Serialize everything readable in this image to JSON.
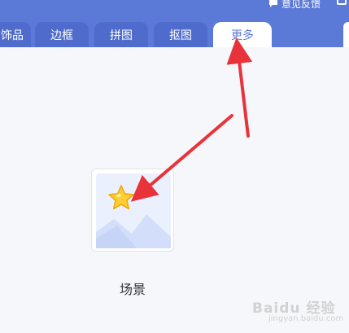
{
  "header": {
    "feedback_label": "意见反馈",
    "tabs": [
      {
        "label": "饰品",
        "active": false
      },
      {
        "label": "边框",
        "active": false
      },
      {
        "label": "拼图",
        "active": false
      },
      {
        "label": "抠图",
        "active": false
      },
      {
        "label": "更多",
        "active": true
      }
    ]
  },
  "main": {
    "scene_card_label": "场景"
  },
  "watermark": {
    "text": "Baidu 经验",
    "sub": "jingyan.baidu.com"
  },
  "colors": {
    "header_bg": "#5b79d6",
    "tab_bg": "#4f6ccd",
    "active_tab_text": "#5b79d6",
    "annotation_arrow": "#e8333b"
  }
}
